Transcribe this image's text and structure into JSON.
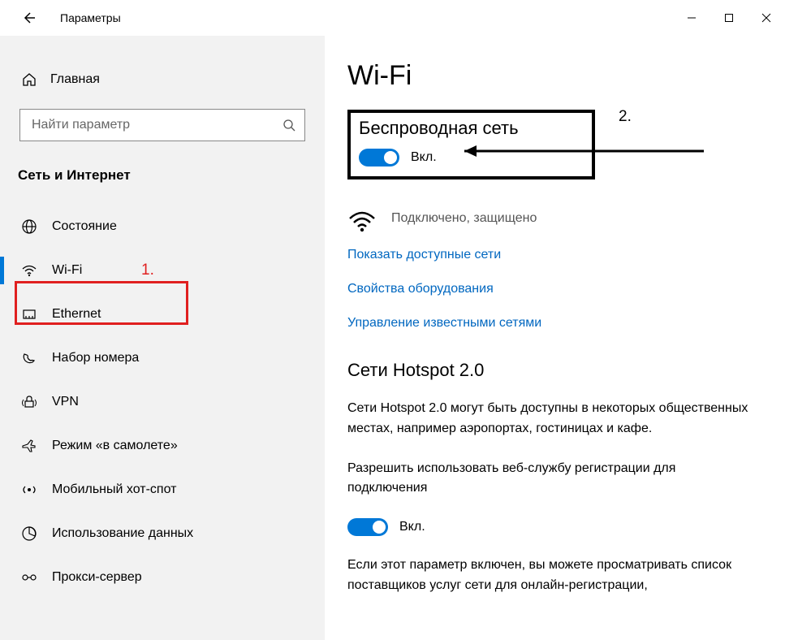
{
  "titlebar": {
    "title": "Параметры"
  },
  "sidebar": {
    "home_label": "Главная",
    "search_placeholder": "Найти параметр",
    "section_title": "Сеть и Интернет",
    "items": [
      {
        "label": "Состояние",
        "icon": "globe"
      },
      {
        "label": "Wi-Fi",
        "icon": "wifi",
        "selected": true
      },
      {
        "label": "Ethernet",
        "icon": "ethernet"
      },
      {
        "label": "Набор номера",
        "icon": "dialup"
      },
      {
        "label": "VPN",
        "icon": "vpn"
      },
      {
        "label": "Режим «в самолете»",
        "icon": "airplane"
      },
      {
        "label": "Мобильный хот-спот",
        "icon": "hotspot"
      },
      {
        "label": "Использование данных",
        "icon": "data-usage"
      },
      {
        "label": "Прокси-сервер",
        "icon": "proxy"
      }
    ],
    "annotation_1": "1."
  },
  "main": {
    "page_title": "Wi-Fi",
    "wireless": {
      "heading": "Беспроводная сеть",
      "toggle_label": "Вкл.",
      "annotation_2": "2."
    },
    "status_text": "Подключено, защищено",
    "links": {
      "show_networks": "Показать доступные сети",
      "hardware_properties": "Свойства оборудования",
      "known_networks": "Управление известными сетями"
    },
    "hotspot": {
      "heading": "Сети Hotspot 2.0",
      "description": "Сети Hotspot 2.0 могут быть доступны в некоторых общественных местах, например аэропортах, гостиницах и кафе.",
      "permission_text": "Разрешить использовать веб-службу регистрации для подключения",
      "toggle_label": "Вкл.",
      "info_text": "Если этот параметр включен, вы можете просматривать список поставщиков услуг сети для онлайн-регистрации,"
    }
  }
}
